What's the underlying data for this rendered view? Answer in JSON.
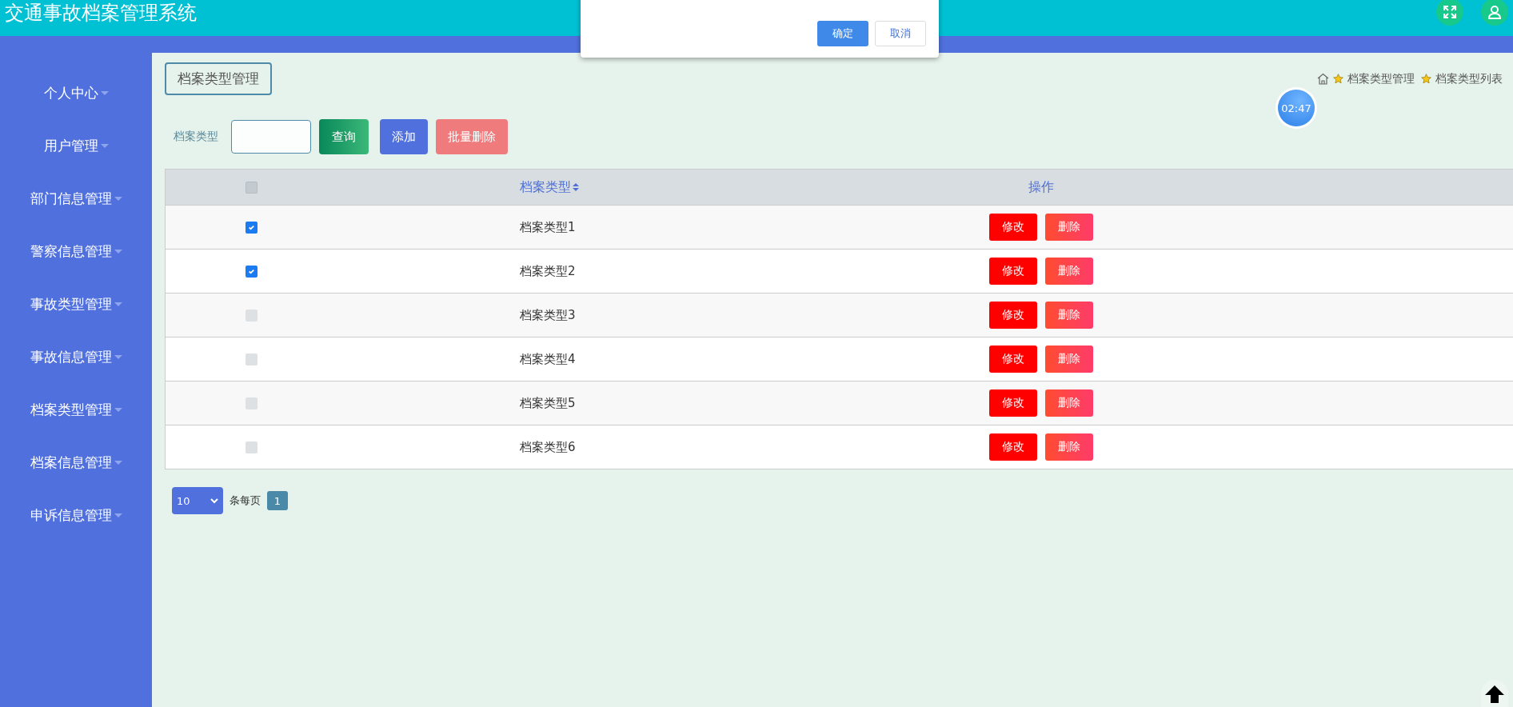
{
  "header": {
    "title": "交通事故档案管理系统"
  },
  "dialog": {
    "buttons": [
      "确定",
      "取消"
    ]
  },
  "sidebar": {
    "items": [
      {
        "label": "个人中心"
      },
      {
        "label": "用户管理"
      },
      {
        "label": "部门信息管理"
      },
      {
        "label": "警察信息管理"
      },
      {
        "label": "事故类型管理"
      },
      {
        "label": "事故信息管理"
      },
      {
        "label": "档案类型管理"
      },
      {
        "label": "档案信息管理"
      },
      {
        "label": "申诉信息管理"
      }
    ]
  },
  "page_title": "档案类型管理",
  "breadcrumb": [
    "档案类型管理",
    "档案类型列表"
  ],
  "timer": "02:47",
  "search": {
    "label": "档案类型",
    "buttons": [
      "查询",
      "添加",
      "批量删除"
    ]
  },
  "table": {
    "select_all": {
      "checked": false
    },
    "columns": [
      "档案类型",
      "操作"
    ],
    "rows": [
      {
        "checked": true,
        "name": "档案类型1",
        "actions": [
          "修改",
          "删除"
        ]
      },
      {
        "checked": true,
        "name": "档案类型2",
        "actions": [
          "修改",
          "删除"
        ]
      },
      {
        "checked": false,
        "name": "档案类型3",
        "actions": [
          "修改",
          "删除"
        ]
      },
      {
        "checked": false,
        "name": "档案类型4",
        "actions": [
          "修改",
          "删除"
        ]
      },
      {
        "checked": false,
        "name": "档案类型5",
        "actions": [
          "修改",
          "删除"
        ]
      },
      {
        "checked": false,
        "name": "档案类型6",
        "actions": [
          "修改",
          "删除"
        ]
      }
    ]
  },
  "pagination": {
    "page_size": "10",
    "per_page_label": "条每页",
    "pages": [
      {
        "label": "1",
        "selected": true
      }
    ]
  }
}
